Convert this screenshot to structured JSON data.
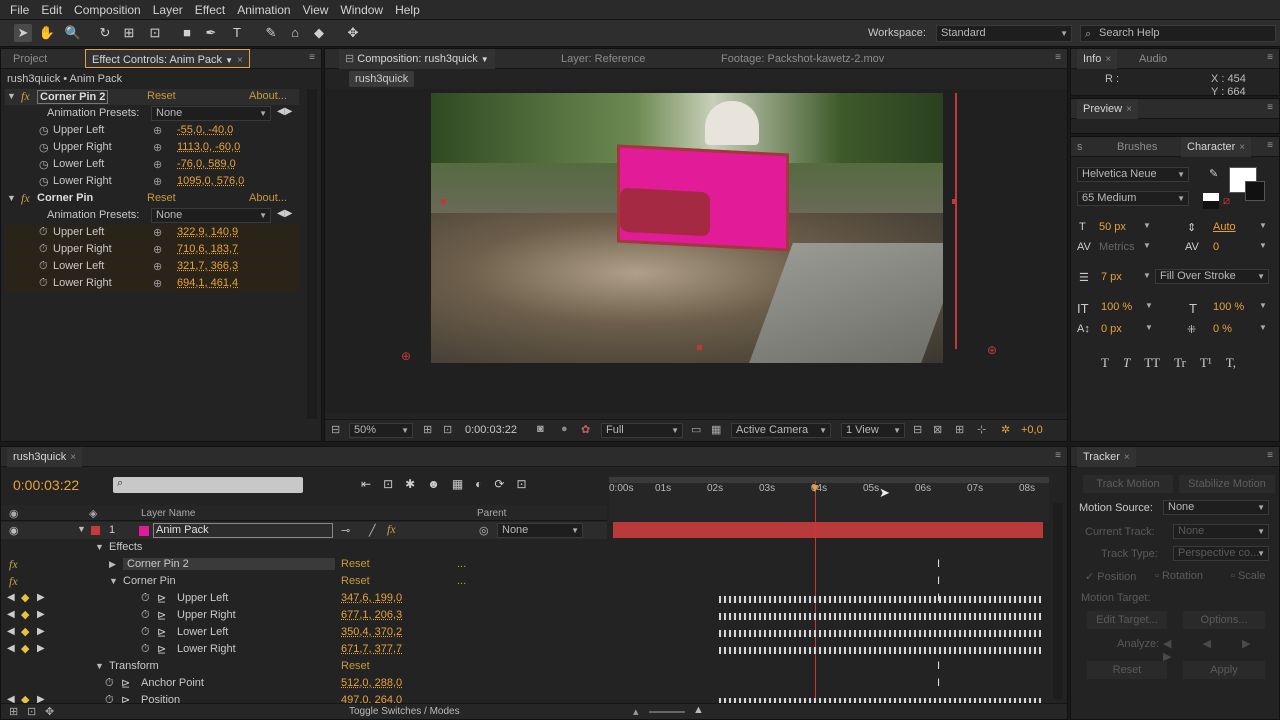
{
  "menu": [
    "File",
    "Edit",
    "Composition",
    "Layer",
    "Effect",
    "Animation",
    "View",
    "Window",
    "Help"
  ],
  "toolbar": {
    "workspace_label": "Workspace:",
    "workspace_value": "Standard",
    "search_placeholder": "Search Help"
  },
  "left_panel": {
    "tabs": [
      "Project",
      "Effect Controls: Anim Pack"
    ],
    "breadcrumb": "rush3quick • Anim Pack",
    "effects": [
      {
        "name": "Corner Pin 2",
        "reset": "Reset",
        "about": "About...",
        "presets_label": "Animation Presets:",
        "presets_value": "None",
        "props": [
          {
            "label": "Upper Left",
            "value": "-55,0, -40,0"
          },
          {
            "label": "Upper Right",
            "value": "1113,0, -60,0"
          },
          {
            "label": "Lower Left",
            "value": "-76,0, 589,0"
          },
          {
            "label": "Lower Right",
            "value": "1095,0, 576,0"
          }
        ]
      },
      {
        "name": "Corner Pin",
        "reset": "Reset",
        "about": "About...",
        "presets_label": "Animation Presets:",
        "presets_value": "None",
        "props": [
          {
            "label": "Upper Left",
            "value": "322,9, 140,9"
          },
          {
            "label": "Upper Right",
            "value": "710,6, 183,7"
          },
          {
            "label": "Lower Left",
            "value": "321,7, 366,3"
          },
          {
            "label": "Lower Right",
            "value": "694,1, 461,4"
          }
        ]
      }
    ]
  },
  "comp_panel": {
    "tabs": [
      "Composition: rush3quick",
      "Layer: Reference",
      "Footage: Packshot-kawetz-2.mov"
    ],
    "comp_tab": "rush3quick",
    "zoom": "50%",
    "timecode": "0:00:03:22",
    "resolution": "Full",
    "camera": "Active Camera",
    "views": "1 View",
    "exposure": "+0,0"
  },
  "info_panel": {
    "tabs": [
      "Info",
      "Audio"
    ],
    "r_label": "R :",
    "x_label": "X : 454",
    "y_label": "Y : 664"
  },
  "preview_panel": {
    "tab": "Preview"
  },
  "character_panel": {
    "tabs": [
      "s",
      "Brushes",
      "Character"
    ],
    "font": "Helvetica Neue",
    "style": "65 Medium",
    "size": "50 px",
    "leading": "Auto",
    "kerning": "Metrics",
    "tracking": "0",
    "stroke_width": "7 px",
    "stroke_type": "Fill Over Stroke",
    "vscale": "100 %",
    "hscale": "100 %",
    "baseline": "0 px",
    "tsume": "0 %",
    "styles": [
      "T",
      "T",
      "TT",
      "Tr",
      "T¹",
      "T,"
    ]
  },
  "tracker_panel": {
    "tab": "Tracker",
    "track_motion": "Track Motion",
    "stabilize_motion": "Stabilize Motion",
    "motion_source_label": "Motion Source:",
    "motion_source": "None",
    "current_track_label": "Current Track:",
    "current_track": "None",
    "track_type_label": "Track Type:",
    "track_type": "Perspective co...",
    "position": "Position",
    "rotation": "Rotation",
    "scale": "Scale",
    "motion_target": "Motion Target:",
    "edit_target": "Edit Target...",
    "options": "Options...",
    "analyze": "Analyze:",
    "reset": "Reset",
    "apply": "Apply"
  },
  "timeline": {
    "tab": "rush3quick",
    "timecode": "0:00:03:22",
    "col_layer_name": "Layer Name",
    "col_parent": "Parent",
    "parent_value": "None",
    "layer_num": "1",
    "layer_name": "Anim Pack",
    "rows": [
      {
        "label": "Effects",
        "value": ""
      },
      {
        "label": "Corner Pin 2",
        "value": "Reset"
      },
      {
        "label": "Corner Pin",
        "value": "Reset"
      },
      {
        "label": "Upper Left",
        "value": "347,6, 199,0"
      },
      {
        "label": "Upper Right",
        "value": "677,1, 206,3"
      },
      {
        "label": "Lower Left",
        "value": "350,4, 370,2"
      },
      {
        "label": "Lower Right",
        "value": "671,7, 377,7"
      },
      {
        "label": "Transform",
        "value": "Reset"
      },
      {
        "label": "Anchor Point",
        "value": "512,0, 288,0"
      },
      {
        "label": "Position",
        "value": "497,0, 264,0"
      }
    ],
    "ruler": [
      "0:00s",
      "01s",
      "02s",
      "03s",
      "04s",
      "05s",
      "06s",
      "07s",
      "08s"
    ],
    "toggle": "Toggle Switches / Modes"
  }
}
